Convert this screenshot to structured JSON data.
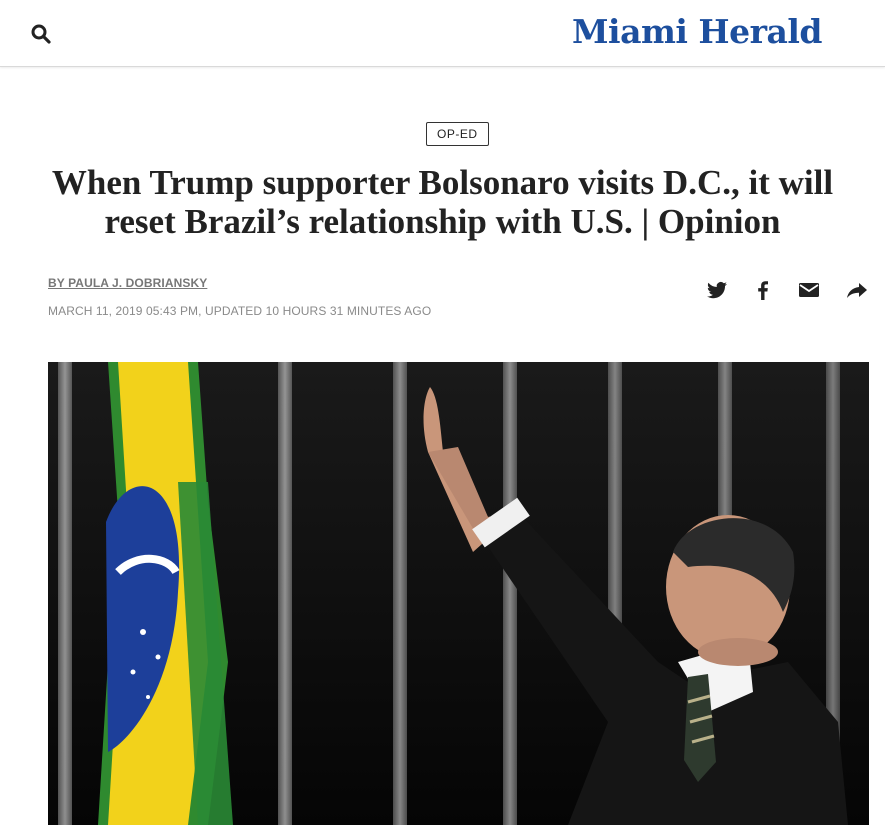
{
  "header": {
    "logo_text": "Miami Herald",
    "search_icon": "search-icon"
  },
  "article": {
    "section_tag": "OP-ED",
    "headline": "When Trump supporter Bolsonaro visits D.C., it will reset Brazil’s relationship with U.S. | Opinion",
    "byline": "BY PAULA J. DOBRIANSKY",
    "dateline": "MARCH 11, 2019 05:43 PM,  UPDATED 10 HOURS 31 MINUTES AGO"
  },
  "share_icons": [
    "twitter-icon",
    "facebook-icon",
    "email-icon",
    "share-icon"
  ],
  "colors": {
    "brand": "#1d4f9e",
    "headline": "#222222",
    "meta": "#8a8a8a"
  }
}
